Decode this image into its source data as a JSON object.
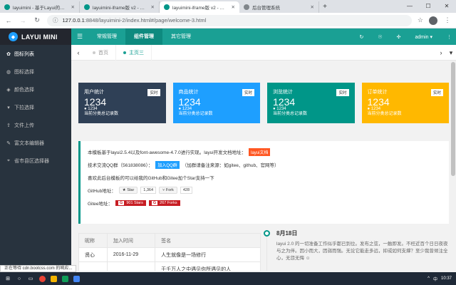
{
  "browser": {
    "tabs": [
      {
        "title": "layuimini - 基于Layui的后台管理系统",
        "active": false
      },
      {
        "title": "layuimini-iframe版 v2 - 基于Layui的后台",
        "active": false
      },
      {
        "title": "layuimini-iframe版 v2 - 基于Layui的后台",
        "active": true
      },
      {
        "title": "后台管理系统",
        "active": false
      }
    ],
    "new_tab": "+",
    "window_controls": [
      "—",
      "☐",
      "✕"
    ],
    "url_host": "127.0.0.1",
    "url_path": ":8848/layuimini-2/index.html#/page/welcome-3.html",
    "info_icon": "ⓘ",
    "back": "←",
    "forward": "→",
    "reload": "↻",
    "star": "☆",
    "more": "⋮"
  },
  "app": {
    "logo_text": "LAYUI MINI",
    "header_nav": [
      "常规管理",
      "组件管理",
      "其它管理"
    ],
    "header_active_index": 1,
    "header_icons": [
      "↻",
      "☉",
      "✣"
    ],
    "user": "admin ▾",
    "header_more": "⋮",
    "menu_toggle": "☰"
  },
  "sidebar": {
    "items": [
      {
        "icon": "✿",
        "label": "图标列表",
        "active": true
      },
      {
        "icon": "◍",
        "label": "图标选择",
        "active": false
      },
      {
        "icon": "◈",
        "label": "颜色选择",
        "active": false
      },
      {
        "icon": "▾",
        "label": "下拉选择",
        "active": false
      },
      {
        "icon": "⇪",
        "label": "文件上传",
        "active": false
      },
      {
        "icon": "✎",
        "label": "富文本编辑器",
        "active": false
      },
      {
        "icon": "⌖",
        "label": "省市县区选择器",
        "active": false
      }
    ]
  },
  "page_tabs": {
    "left_arrow": "‹",
    "items": [
      {
        "label": "首页",
        "active": false
      },
      {
        "label": "主页三",
        "active": true
      }
    ],
    "right_icons": [
      "›",
      "▾"
    ]
  },
  "cards": [
    {
      "title": "用户统计",
      "badge": "实时",
      "value": "1234",
      "sub_value": "1234",
      "sub_label": "当前分类总记录数",
      "color": "#2f4056"
    },
    {
      "title": "商品统计",
      "badge": "实时",
      "value": "1234",
      "sub_value": "1234",
      "sub_label": "当前分类总记录数",
      "color": "#1e9fff"
    },
    {
      "title": "浏览统计",
      "badge": "实时",
      "value": "1234",
      "sub_value": "1234",
      "sub_label": "当前分类总记录数",
      "color": "#009688"
    },
    {
      "title": "订单统计",
      "badge": "实时",
      "value": "1234",
      "sub_value": "1234",
      "sub_label": "当前分类总记录数",
      "color": "#ffb800"
    }
  ],
  "notice": {
    "line1": "本模板基于layui2.5.4以及font-awesome-4.7.0进行实现。layui开发文档地址：",
    "line1_tag": "layui文档",
    "line2": "技术交流QQ群（561838086）：",
    "line2_btn": "加入QQ群",
    "line2_tail": "（加群请备注来源：如gitee、github、官网等）",
    "line3": "喜欢此后台模板的可以给我的GitHub和Gitee加个Star支持一下",
    "github_label": "GitHub地址：",
    "github_star": "★ Star",
    "github_star_count": "1,364",
    "github_fork": "⑂ Fork",
    "github_fork_count": "428",
    "gitee_label": "Gitee地址：",
    "gitee_stars": "901 Stars",
    "gitee_forks": "267 Forks",
    "gitee_logo": "G"
  },
  "table": {
    "headers": [
      "昵称",
      "加入时间",
      "签名"
    ],
    "rows": [
      [
        "贤心",
        "2016-11-29",
        "人生就像是一场修行"
      ],
      [
        "",
        "",
        "于千万人之中遇见你所遇见的人"
      ]
    ]
  },
  "timeline": {
    "date": "8月18日",
    "text": "layui 2.0 的一切准备工作似乎都已到位。发布之弦，一触即发。不枉近百个日日夜夜与之为伴。因小而大，因弱而强。无论它能走多远，抑或如何支撑？至少我曾倾注全心，无怨无悔 ☺"
  },
  "status_text": "正在等待 cdn.bootcss.com 的响应...",
  "taskbar": {
    "time": "10:37",
    "tray": [
      "^",
      "中"
    ]
  }
}
